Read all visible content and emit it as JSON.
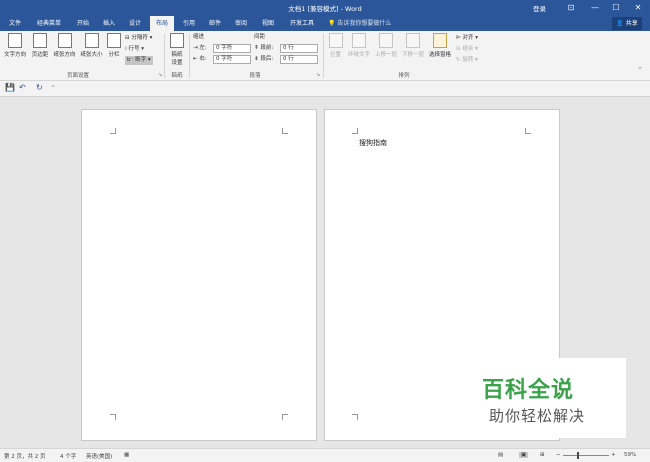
{
  "window": {
    "title": "文档1 [兼容模式] - Word",
    "login": "登录",
    "minimize": "—",
    "restore": "☐",
    "close": "✕",
    "ribbon_display": "⊡"
  },
  "tabs": [
    {
      "label": "文件"
    },
    {
      "label": "经典菜单"
    },
    {
      "label": "开始"
    },
    {
      "label": "插入"
    },
    {
      "label": "设计"
    },
    {
      "label": "布局",
      "active": true
    },
    {
      "label": "引用"
    },
    {
      "label": "邮件"
    },
    {
      "label": "审阅"
    },
    {
      "label": "视图"
    },
    {
      "label": "开发工具"
    }
  ],
  "tellme": "告诉我你想要做什么",
  "share": "共享",
  "ribbon": {
    "page_setup": {
      "label": "页面设置",
      "text_direction": "文字方向",
      "margins": "页边距",
      "orientation": "纸张方向",
      "size": "纸张大小",
      "columns": "分栏",
      "breaks": "分隔符",
      "line_numbers": "行号",
      "hyphenation": "断字"
    },
    "draft": {
      "label": "稿纸",
      "draft_settings_1": "稿纸",
      "draft_settings_2": "设置"
    },
    "paragraph": {
      "label": "段落",
      "indent": "缩进",
      "spacing": "间距",
      "left_label": "左:",
      "left_value": "0 字符",
      "right_label": "右:",
      "right_value": "0 字符",
      "before_label": "段前:",
      "before_value": "0 行",
      "after_label": "段后:",
      "after_value": "0 行"
    },
    "arrange": {
      "label": "排列",
      "position": "位置",
      "wrap_text": "环绕文字",
      "bring_forward": "上移一层",
      "send_backward": "下移一层",
      "selection_pane": "选择窗格",
      "align": "对齐",
      "group": "组合",
      "rotate": "旋转"
    }
  },
  "qat": {
    "save": "💾",
    "undo": "↶",
    "redo": "↻",
    "more": "⁼"
  },
  "document": {
    "text": "搜狗指南"
  },
  "watermark": {
    "line1": "百科全说",
    "line2": "助你轻松解决"
  },
  "status": {
    "page": "第 2 页，共 2 页",
    "words": "4 个字",
    "language": "英语(美国)",
    "zoom": "59%"
  },
  "colors": {
    "accent": "#2b579a",
    "watermark_green": "#3aa34a"
  }
}
